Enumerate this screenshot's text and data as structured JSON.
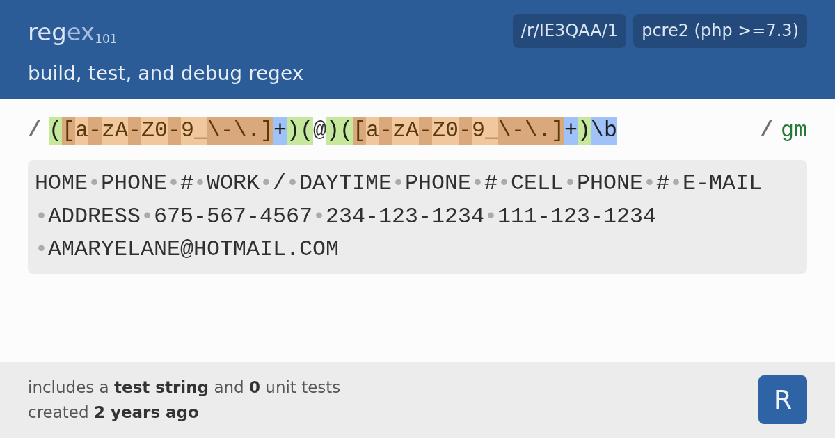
{
  "header": {
    "logo": [
      {
        "text": "reg",
        "kind": "main"
      },
      {
        "text": "ex",
        "kind": "accent"
      },
      {
        "text": "101",
        "kind": "version"
      }
    ],
    "tagline": "build, test, and debug regex",
    "badges": [
      "/r/IE3QAA/1",
      "pcre2 (php >=7.3)"
    ]
  },
  "regex": {
    "open_delimiter": "/",
    "tokens": [
      {
        "text": "(",
        "kind": "group"
      },
      {
        "text": "[",
        "kind": "set-meta"
      },
      {
        "text": "a",
        "kind": "set-char"
      },
      {
        "text": "-",
        "kind": "set-meta"
      },
      {
        "text": "zA",
        "kind": "set-char"
      },
      {
        "text": "-",
        "kind": "set-meta"
      },
      {
        "text": "Z0",
        "kind": "set-char"
      },
      {
        "text": "-",
        "kind": "set-meta"
      },
      {
        "text": "9_",
        "kind": "set-char"
      },
      {
        "text": "\\-\\.]",
        "kind": "set-meta"
      },
      {
        "text": "+",
        "kind": "quantifier"
      },
      {
        "text": ")(",
        "kind": "group"
      },
      {
        "text": "@",
        "kind": "literal"
      },
      {
        "text": ")(",
        "kind": "group"
      },
      {
        "text": "[",
        "kind": "set-meta"
      },
      {
        "text": "a",
        "kind": "set-char"
      },
      {
        "text": "-",
        "kind": "set-meta"
      },
      {
        "text": "zA",
        "kind": "set-char"
      },
      {
        "text": "-",
        "kind": "set-meta"
      },
      {
        "text": "Z0",
        "kind": "set-char"
      },
      {
        "text": "-",
        "kind": "set-meta"
      },
      {
        "text": "9_",
        "kind": "set-char"
      },
      {
        "text": "\\-\\.]",
        "kind": "set-meta"
      },
      {
        "text": "+",
        "kind": "quantifier"
      },
      {
        "text": ")",
        "kind": "group"
      },
      {
        "text": "\\b",
        "kind": "anchor"
      }
    ],
    "close_delimiter": "/",
    "flags": "gm"
  },
  "test_string": {
    "lines": [
      {
        "segments": [
          {
            "text": "HOME",
            "kind": "text"
          },
          {
            "text": "•",
            "kind": "whitespace"
          },
          {
            "text": "PHONE",
            "kind": "text"
          },
          {
            "text": "•",
            "kind": "whitespace"
          },
          {
            "text": "#",
            "kind": "text"
          },
          {
            "text": "•",
            "kind": "whitespace"
          },
          {
            "text": "WORK",
            "kind": "text"
          },
          {
            "text": "•",
            "kind": "whitespace"
          },
          {
            "text": "/",
            "kind": "text"
          },
          {
            "text": "•",
            "kind": "whitespace"
          },
          {
            "text": "DAYTIME",
            "kind": "text"
          },
          {
            "text": "•",
            "kind": "whitespace"
          },
          {
            "text": "PHONE",
            "kind": "text"
          },
          {
            "text": "•",
            "kind": "whitespace"
          },
          {
            "text": "#",
            "kind": "text"
          },
          {
            "text": "•",
            "kind": "whitespace"
          },
          {
            "text": "CELL",
            "kind": "text"
          },
          {
            "text": "•",
            "kind": "whitespace"
          },
          {
            "text": "PHONE",
            "kind": "text"
          },
          {
            "text": "•",
            "kind": "whitespace"
          },
          {
            "text": "#",
            "kind": "text"
          },
          {
            "text": "•",
            "kind": "whitespace"
          },
          {
            "text": "E-MAIL",
            "kind": "text"
          }
        ]
      },
      {
        "segments": [
          {
            "text": "•",
            "kind": "whitespace"
          },
          {
            "text": "ADDRESS",
            "kind": "text"
          },
          {
            "text": "•",
            "kind": "whitespace"
          },
          {
            "text": "675-567-4567",
            "kind": "text"
          },
          {
            "text": "•",
            "kind": "whitespace"
          },
          {
            "text": "234-123-1234",
            "kind": "text"
          },
          {
            "text": "•",
            "kind": "whitespace"
          },
          {
            "text": "111-123-1234",
            "kind": "text"
          }
        ]
      },
      {
        "segments": [
          {
            "text": "•",
            "kind": "whitespace"
          },
          {
            "text": "AMARYELANE@HOTMAIL.COM",
            "kind": "text"
          }
        ]
      }
    ]
  },
  "footer": {
    "summary": "includes a **test string** and **0** unit tests",
    "created": "created **2 years ago**",
    "avatar": "R"
  }
}
